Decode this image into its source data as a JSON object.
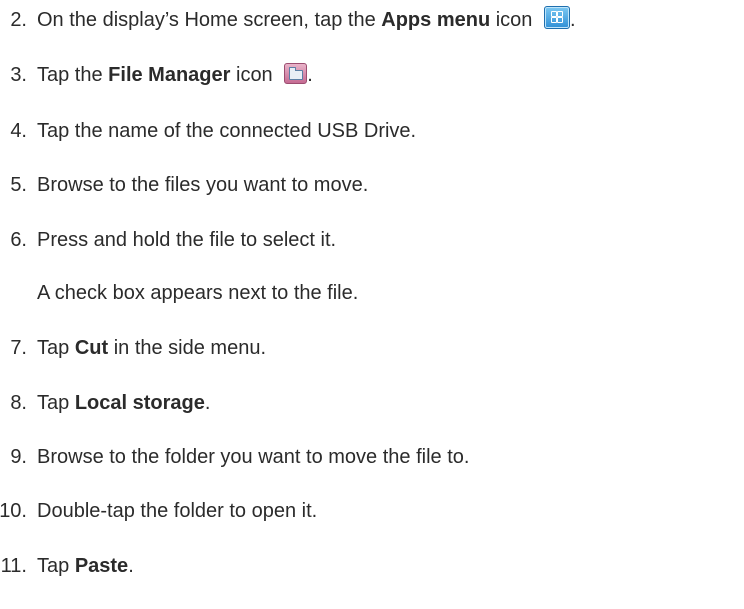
{
  "steps": [
    {
      "number": "2.",
      "before": "On the display’s Home screen, tap the ",
      "bold": "Apps menu",
      "after": " icon ",
      "icon": "apps-menu-icon",
      "trailing": "."
    },
    {
      "number": "3.",
      "before": "Tap the ",
      "bold": "File Manager",
      "after": " icon ",
      "icon": "file-manager-icon",
      "trailing": "."
    },
    {
      "number": "4.",
      "before": "Tap the name of the connected USB Drive.",
      "bold": "",
      "after": "",
      "trailing": ""
    },
    {
      "number": "5.",
      "before": "Browse to the files you want to move.",
      "bold": "",
      "after": "",
      "trailing": ""
    },
    {
      "number": "6.",
      "before": "Press and hold the file to select it.",
      "bold": "",
      "after": "",
      "trailing": ""
    },
    {
      "number": "7.",
      "before": "Tap ",
      "bold": "Cut",
      "after": " in the side menu.",
      "trailing": ""
    },
    {
      "number": "8.",
      "before": "Tap ",
      "bold": "Local storage",
      "after": ".",
      "trailing": ""
    },
    {
      "number": "9.",
      "before": "Browse to the folder you want to move the file to.",
      "bold": "",
      "after": "",
      "trailing": ""
    },
    {
      "number": "10.",
      "before": "Double-tap the folder to open it.",
      "bold": "",
      "after": "",
      "trailing": ""
    },
    {
      "number": "11.",
      "before": "Tap ",
      "bold": "Paste",
      "after": ".",
      "trailing": ""
    }
  ],
  "note": "A check box appears next to the file."
}
